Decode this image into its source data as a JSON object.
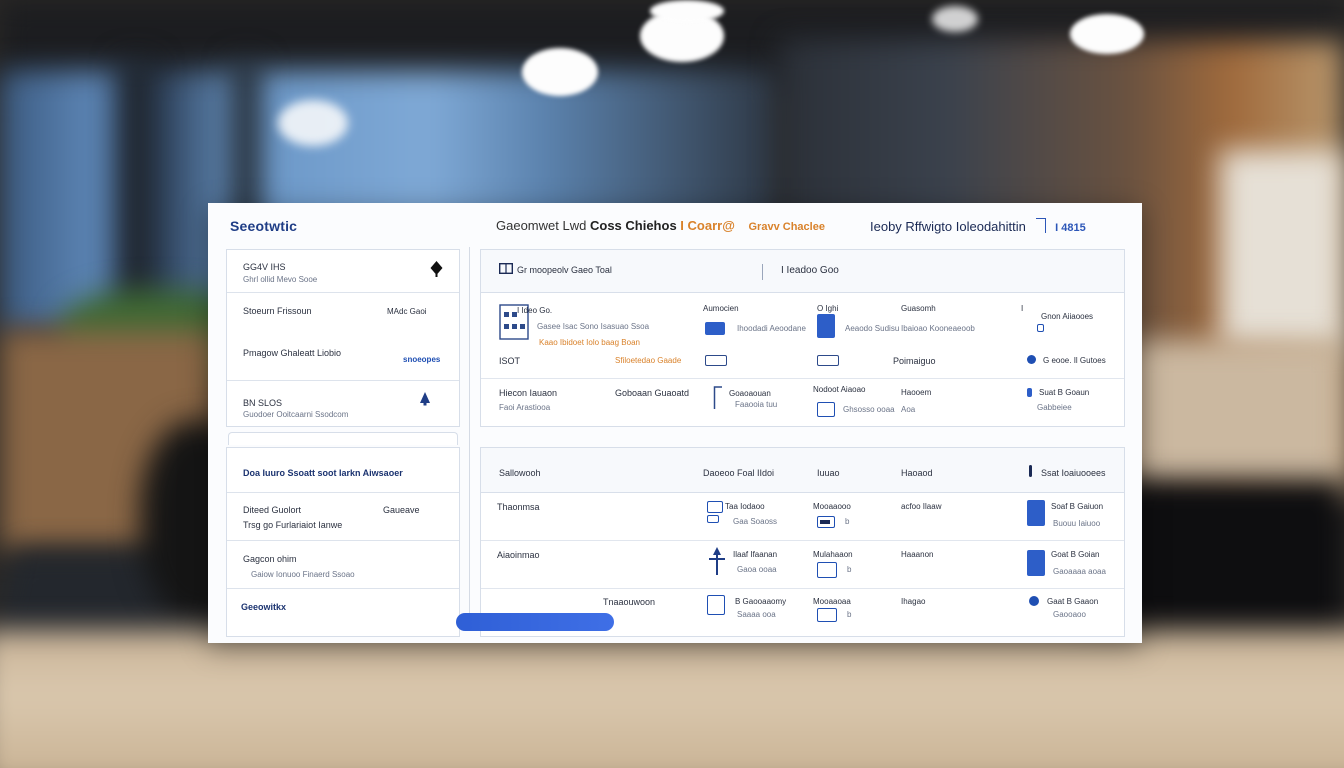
{
  "header": {
    "brand": "Seeotwtic",
    "mid_1": "Gaeomwet",
    "mid_2": "Lwd",
    "mid_3": "Coss Chiehos",
    "mid_4": "I Coarr@",
    "mid_5": "Gravv Chaclee",
    "right_title": "Ieoby Rffwigto Ioleodahittin",
    "right_count": "I 4815"
  },
  "left_panel": {
    "card1": {
      "item1_title": "GG4V IHS",
      "item1_sub": "Ghrl ollid Mevo Sooe",
      "item2_title": "Stoeurn Frissoun",
      "item2_tag": "MAdc Gaoi",
      "item3_title": "Pmagow Ghaleatt Liobio",
      "item3_tag": "snoeopes",
      "item4_title": "BN SLOS",
      "item4_sub": "Guodoer Ooitcaarni Ssodcom"
    },
    "card2": {
      "heading": "Doa Iuuro Ssoatt soot Iarkn Aiwsaoer",
      "item1_title": "Diteed Guolort",
      "item1_tag": "Gaueave",
      "item1_sub": "Trsg go Furlariaiot Ianwe",
      "item2_title": "Gagcon ohim",
      "item2_sub": "Gaiow Ionuoo Finaerd Ssoao",
      "footer": "Geeowitkx"
    }
  },
  "table1": {
    "head_left": "Gr moopeolv Gaeo Toal",
    "head_right": "I Ieadoo Goo",
    "r1": {
      "c1a": "I Ideo Go.",
      "c1b": "Gasee Isac Sono Isasuao Ssoa",
      "c1c": "Kaao Ibidoet Iolo baag Boan",
      "c1d": "ISOT",
      "c2a": "Sfiloetedao Gaade",
      "c3a": "Aumocien",
      "c3b": "Ihoodadi Aeoodane",
      "c4a": "O Ighi",
      "c4b": "Aeaodo Sudisu",
      "c5a": "Guasomh",
      "c5b": "Ibaioao Kooneaeoob",
      "c6a": "I",
      "c6b": "Gnon Aiiaooes",
      "c7a": "Poimaiguo",
      "c7b": "G eooe. Il Gutoes"
    },
    "r2": {
      "c1a": "Hiecon Iauaon",
      "c1b": "Faoi Arastiooa",
      "c2a": "Goboaan Guaoatd",
      "c3a": "Goaoaouan",
      "c3b": "Faaooia tuu",
      "c4a": "Nodoot Aiaoao",
      "c4b": "Ghsosso ooaa",
      "c5a": "Haooem",
      "c5b": "Aoa",
      "c6a": "Suat B Goaun",
      "c6b": "Gabbeiee"
    }
  },
  "table2": {
    "h1": "Sallowooh",
    "h2": "Daoeoo Foal IIdoi",
    "h3": "Iuuao",
    "h4": "Haoaod",
    "h5": "Ssat Ioaiuooees",
    "rows": [
      {
        "c1": "Thaonmsa",
        "c2a": "Taa Iodaoo",
        "c2b": "Gaa Soaoss",
        "c3a": "Mooaaooo",
        "c3b": "b",
        "c4": "acfoo Ilaaw",
        "c5a": "Soaf B Gaiuon",
        "c5b": "Buouu Iaiuoo"
      },
      {
        "c1": "Aiaoinmao",
        "c2a": "Ilaaf Ifaanan",
        "c2b": "Gaoa ooaa",
        "c3a": "Mulahaaon",
        "c3b": "b",
        "c4": "Haaanon",
        "c5a": "Goat B Goian",
        "c5b": "Gaoaaaa aoaa"
      },
      {
        "c1": "Tnaaouwoon",
        "c2a": "B Gaooaaomy",
        "c2b": "Saaaa ooa",
        "c3a": "Mooaaoaa",
        "c3b": "b",
        "c4": "Ihagao",
        "c5a": "Gaat B Gaaon",
        "c5b": "Gaooaoo"
      }
    ]
  },
  "progress": {
    "value": 0.5
  },
  "colors": {
    "accent": "#1f4fb3",
    "brand": "#1f3d86",
    "orange": "#d9822b"
  }
}
